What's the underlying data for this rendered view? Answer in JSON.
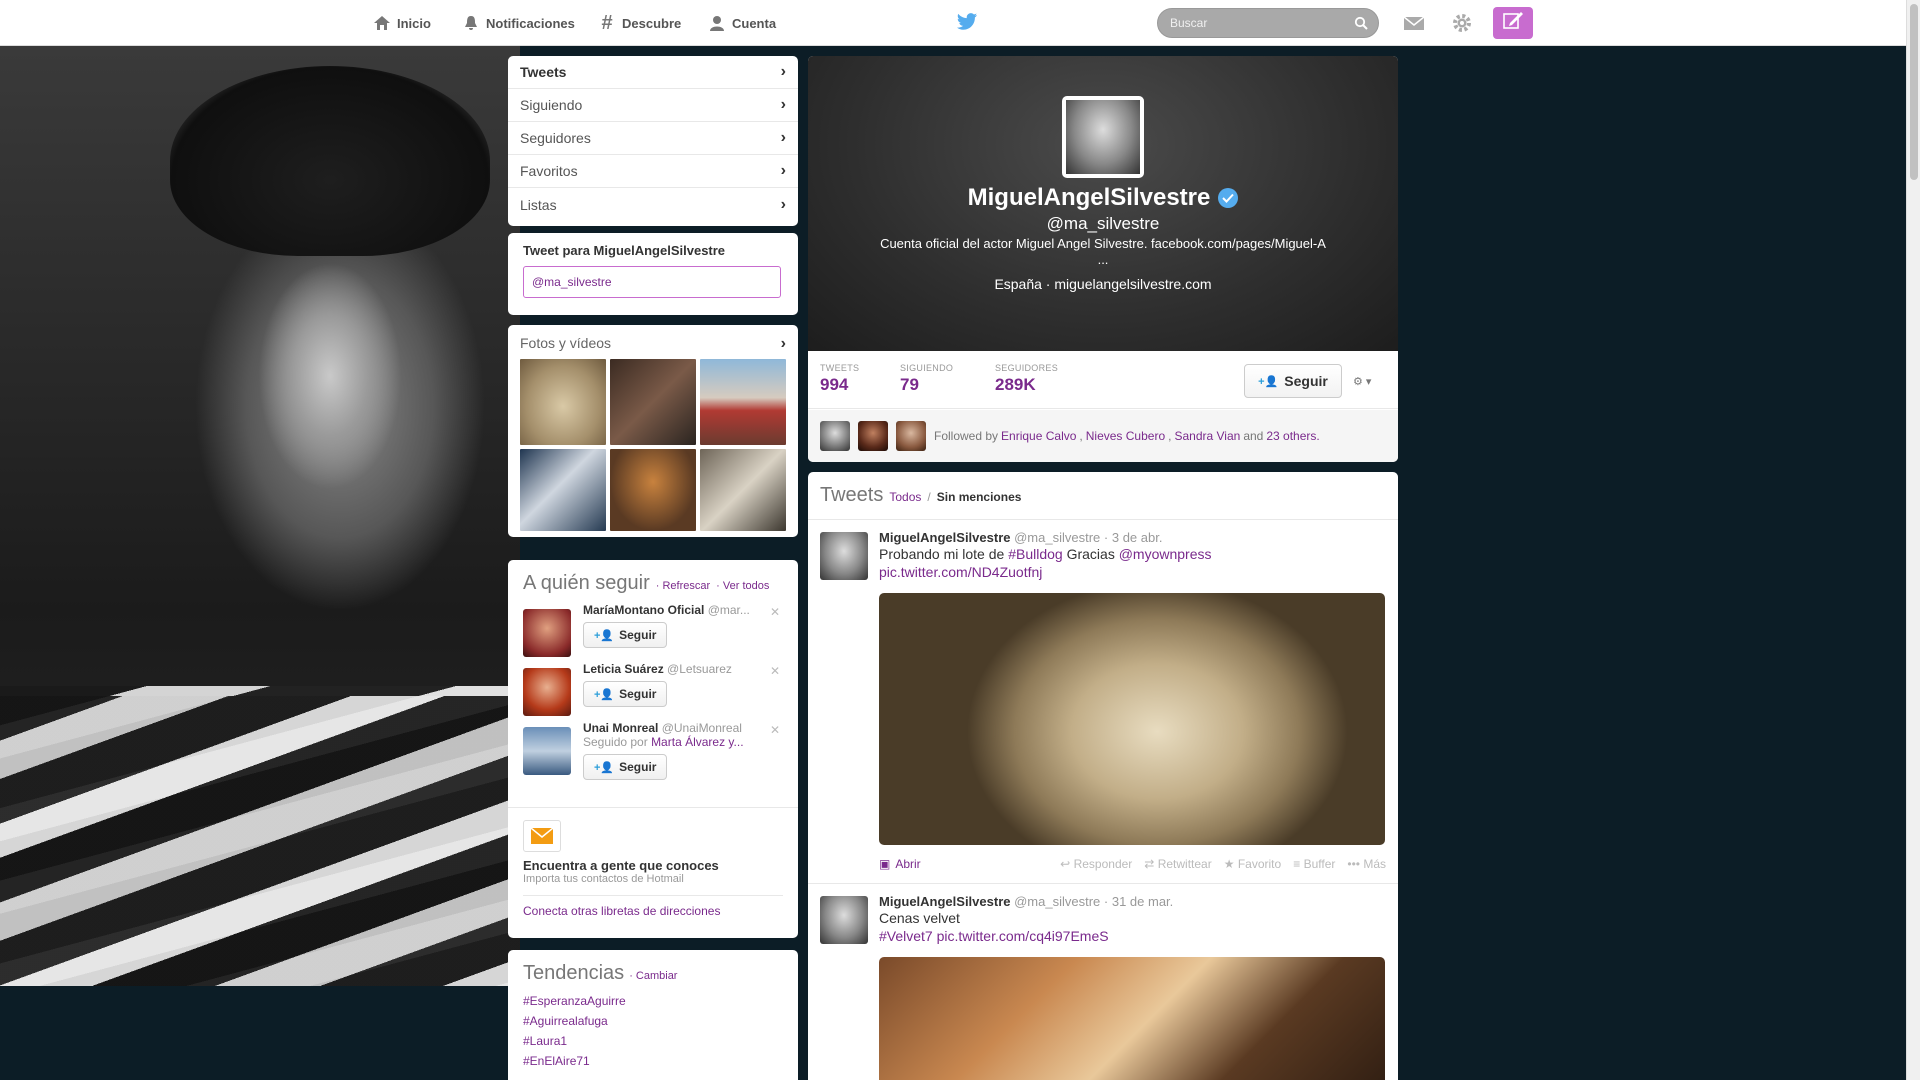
{
  "nav": {
    "home": "Inicio",
    "notifications": "Notificaciones",
    "discover": "Descubre",
    "account": "Cuenta",
    "search_placeholder": "Buscar"
  },
  "profile_nav": {
    "items": [
      {
        "label": "Tweets"
      },
      {
        "label": "Siguiendo"
      },
      {
        "label": "Seguidores"
      },
      {
        "label": "Favoritos"
      },
      {
        "label": "Listas"
      }
    ]
  },
  "tweet_box": {
    "title": "Tweet para MiguelAngelSilvestre",
    "value": "@ma_silvestre"
  },
  "photos": {
    "title": "Fotos y vídeos"
  },
  "who_to_follow": {
    "title": "A quién seguir",
    "refresh": "· Refrescar",
    "view_all": "· Ver todos",
    "suggestions": [
      {
        "name": "MaríaMontano Oficial",
        "handle": "@mar...",
        "followed_by": "",
        "button": "Seguir"
      },
      {
        "name": "Leticia Suárez",
        "handle": "@Letsuarez",
        "followed_by": "",
        "button": "Seguir"
      },
      {
        "name": "Unai Monreal",
        "handle": "@UnaiMonreal",
        "followed_by_prefix": "Seguido por",
        "followed_by": "Marta Álvarez y...",
        "button": "Seguir"
      }
    ],
    "find_title": "Encuentra a gente que conoces",
    "find_sub": "Importa tus contactos de Hotmail",
    "find_link": "Conecta otras libretas de direcciones"
  },
  "trends": {
    "title": "Tendencias",
    "change": "· Cambiar",
    "items": [
      "#EsperanzaAguirre",
      "#Aguirrealafuga",
      "#Laura1",
      "#EnElAire71"
    ]
  },
  "profile": {
    "name": "MiguelAngelSilvestre",
    "handle": "@ma_silvestre",
    "bio_line1": "Cuenta oficial del actor Miguel Angel Silvestre.  facebook.com/pages/Miguel-A",
    "bio_line2": "...",
    "location": "España",
    "website": "miguelangelsilvestre.com",
    "stats": [
      {
        "label": "TWEETS",
        "value": "994"
      },
      {
        "label": "SIGUIENDO",
        "value": "79"
      },
      {
        "label": "SEGUIDORES",
        "value": "289K"
      }
    ],
    "follow_button": "Seguir",
    "followed_by_prefix": "Followed by",
    "followed_by_names": [
      "Enrique Calvo",
      "Nieves Cubero",
      "Sandra Vian"
    ],
    "followed_by_and": "and",
    "followed_by_others": "23 others."
  },
  "tweets": {
    "title": "Tweets",
    "filter_all": "Todos",
    "filter_sep": "/",
    "filter_no_mentions": "Sin menciones",
    "items": [
      {
        "name": "MiguelAngelSilvestre",
        "handle": "@ma_silvestre",
        "date": "· 3 de abr.",
        "text_pre": "Probando mi lote de",
        "hashtag": "#Bulldog",
        "text_mid": "Gracias",
        "mention": "@myownpress",
        "link": "pic.twitter.com/ND4Zuotfnj",
        "open": "Abrir",
        "actions": [
          "Responder",
          "Retwittear",
          "Favorito",
          "Buffer",
          "Más"
        ]
      },
      {
        "name": "MiguelAngelSilvestre",
        "handle": "@ma_silvestre",
        "date": "· 31 de mar.",
        "text": "Cenas velvet",
        "hashtag": "#Velvet7",
        "link": "pic.twitter.com/cq4i97EmeS"
      }
    ]
  },
  "colors": {
    "accent": "#7a2a8c",
    "compose": "#c86ccf",
    "verified": "#55acee",
    "background": "#0c1d26"
  }
}
